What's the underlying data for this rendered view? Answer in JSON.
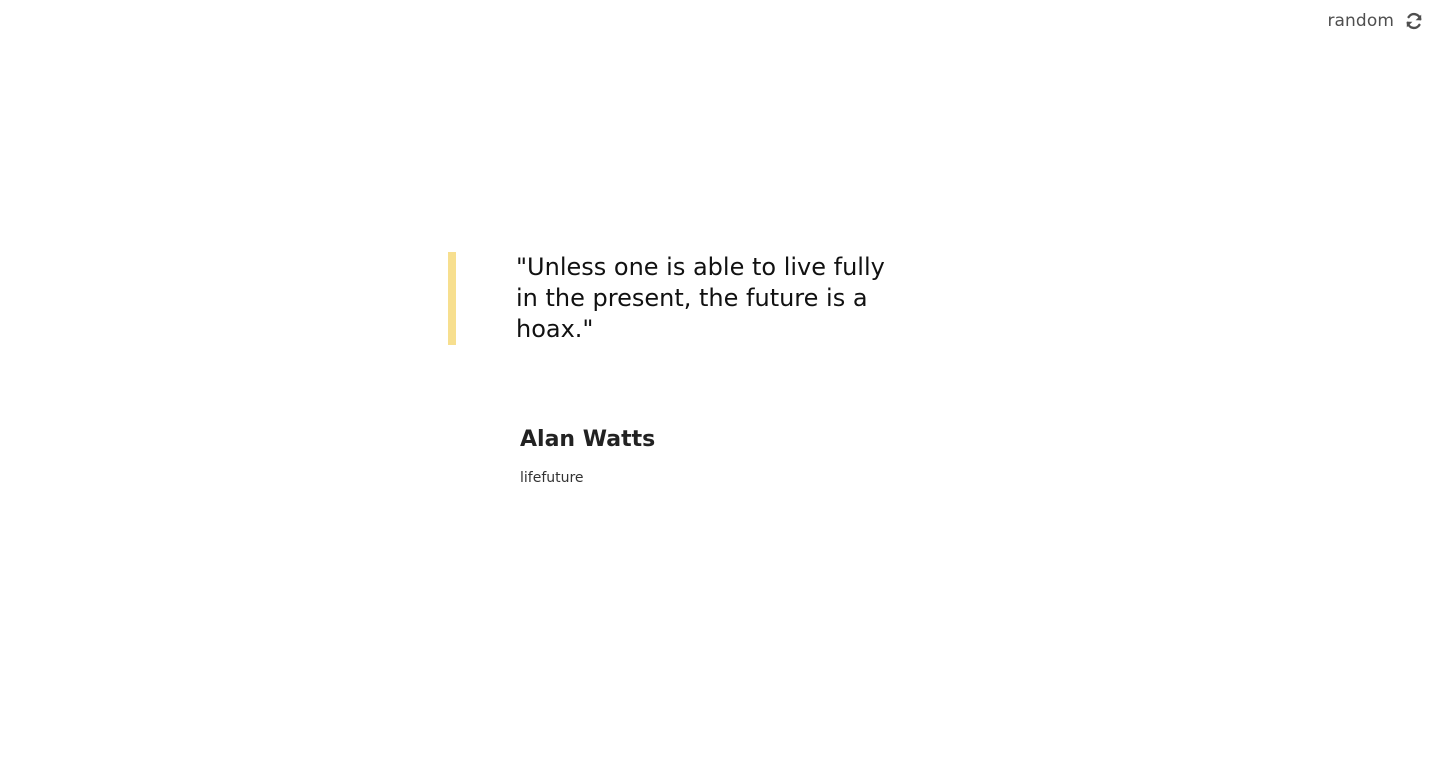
{
  "header": {
    "random_label": "random",
    "random_icon": "refresh-icon"
  },
  "quote": {
    "text": "\"Unless one is able to live fully in the present, the future is a hoax.\"",
    "accent_color": "#f7df8f"
  },
  "author": {
    "name": "Alan Watts",
    "tags": "lifefuture"
  }
}
